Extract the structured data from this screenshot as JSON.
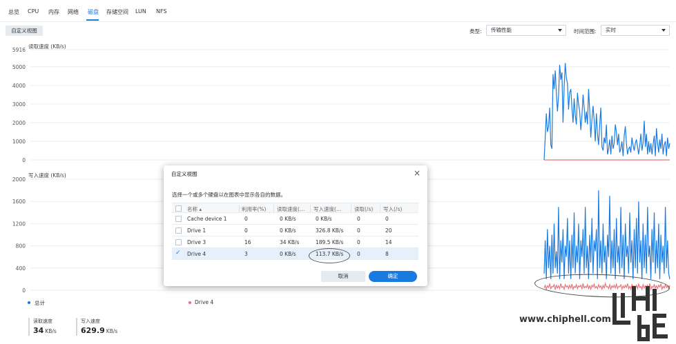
{
  "tabs": [
    {
      "label": "总览",
      "active": false
    },
    {
      "label": "CPU",
      "active": false
    },
    {
      "label": "内存",
      "active": false
    },
    {
      "label": "网络",
      "active": false
    },
    {
      "label": "磁盘",
      "active": true
    },
    {
      "label": "存储空间",
      "active": false
    },
    {
      "label": "LUN",
      "active": false
    },
    {
      "label": "NFS",
      "active": false
    }
  ],
  "toolbar": {
    "custom_view_label": "自定义视图",
    "type_label": "类型:",
    "type_value": "传输性能",
    "range_label": "时间范围:",
    "range_value": "实时"
  },
  "colors": {
    "accent": "#1a7ae0",
    "drive4": "#e8737a"
  },
  "chart_data": [
    {
      "type": "line",
      "ylabel": "读取速度 (KB/s)",
      "ylim": [
        0,
        5916
      ],
      "yticks": [
        "0",
        "1000",
        "2000",
        "3000",
        "4000",
        "5000",
        "5916"
      ],
      "yticks_values": [
        0,
        1000,
        2000,
        3000,
        4000,
        5000,
        5916
      ],
      "series": [
        {
          "name": "总计",
          "color": "#1a7ae0",
          "values": [
            0,
            1200,
            2500,
            1500,
            1800,
            2800,
            800,
            600,
            4600,
            3800,
            4800,
            3600,
            2600,
            3400,
            5100,
            4300,
            4700,
            2000,
            3900,
            5200,
            4400,
            4100,
            2700,
            3600,
            3800,
            2800,
            2000,
            3300,
            2400,
            1900,
            3600,
            3000,
            2600,
            1600,
            2400,
            3500,
            2800,
            2000,
            2600,
            1900,
            3800,
            2700,
            1200,
            2200,
            2900,
            2100,
            1000,
            2500,
            1400,
            800,
            1900,
            2800,
            700,
            500,
            1200,
            900,
            1900,
            300,
            600,
            1100,
            300,
            1300,
            600,
            900,
            1900,
            1500,
            800,
            1400,
            400,
            600,
            1000,
            200,
            1300,
            1800,
            900,
            300,
            600,
            700,
            400,
            1200,
            800,
            500,
            900,
            1100,
            700,
            300,
            800,
            1400,
            500,
            900,
            2100,
            700,
            1400,
            300,
            1000,
            400,
            900,
            300,
            800,
            1300,
            200,
            1700,
            900,
            400,
            1100,
            600,
            1400,
            300,
            800,
            1000,
            200,
            1200,
            600,
            900
          ]
        },
        {
          "name": "Drive 4",
          "color": "#e8737a",
          "values": [
            0,
            0,
            0,
            0,
            0,
            0,
            0,
            0,
            0,
            0,
            0,
            0,
            0,
            0,
            0,
            0,
            0,
            0,
            0,
            0,
            0,
            0,
            0,
            0,
            0,
            0,
            0,
            0,
            0,
            0,
            0,
            0,
            0,
            0,
            0,
            0,
            0,
            0,
            0,
            0,
            0,
            0,
            0,
            0,
            0,
            0,
            0,
            0,
            0,
            0,
            0,
            0,
            0,
            0,
            0,
            0,
            0,
            0,
            0,
            0,
            0,
            0,
            0,
            0,
            0,
            0,
            0,
            0,
            0,
            0,
            0,
            0,
            0,
            0,
            0,
            0,
            0,
            0,
            0,
            0,
            0,
            0,
            0,
            0,
            0,
            0,
            0,
            0,
            0,
            0,
            0,
            0,
            0,
            0,
            0,
            0,
            0,
            0,
            0,
            0,
            0,
            0,
            0,
            0,
            0,
            0,
            0,
            0,
            0,
            0,
            0,
            0,
            0,
            0
          ]
        }
      ]
    },
    {
      "type": "line",
      "ylabel": "写入速度 (KB/s)",
      "ylim": [
        0,
        2000
      ],
      "yticks": [
        "0",
        "400",
        "800",
        "1200",
        "1600",
        "2000"
      ],
      "yticks_values": [
        0,
        400,
        800,
        1200,
        1600,
        2000
      ],
      "series": [
        {
          "name": "总计",
          "color": "#1a7ae0",
          "values": [
            300,
            900,
            200,
            1100,
            400,
            800,
            200,
            1000,
            300,
            1200,
            400,
            700,
            300,
            1500,
            200,
            900,
            500,
            1100,
            200,
            800,
            600,
            1300,
            300,
            900,
            200,
            1000,
            400,
            1400,
            300,
            800,
            500,
            1200,
            200,
            900,
            600,
            1100,
            300,
            1500,
            400,
            800,
            200,
            1000,
            500,
            1300,
            300,
            900,
            700,
            1100,
            200,
            1800,
            400,
            900,
            300,
            1200,
            500,
            800,
            200,
            1000,
            600,
            1700,
            300,
            900,
            400,
            1100,
            200,
            1300,
            500,
            800,
            300,
            1500,
            400,
            1000,
            200,
            1200,
            600,
            800,
            300,
            1400,
            500,
            900,
            200,
            1100,
            400,
            1300,
            300,
            1600,
            500,
            900,
            200,
            1200,
            400,
            1000,
            300,
            1500,
            600,
            800,
            200,
            1100,
            500,
            1400,
            300,
            900,
            400,
            1200,
            200,
            1000,
            500,
            800,
            300,
            1500,
            400,
            900,
            300,
            200
          ]
        },
        {
          "name": "Drive 4",
          "color": "#e8737a",
          "values": [
            40,
            90,
            20,
            80,
            50,
            110,
            30,
            70,
            60,
            100,
            20,
            90,
            40,
            80,
            30,
            120,
            50,
            70,
            20,
            100,
            60,
            80,
            30,
            90,
            40,
            110,
            20,
            70,
            50,
            100,
            30,
            80,
            60,
            90,
            20,
            120,
            40,
            70,
            50,
            100,
            30,
            80,
            20,
            90,
            60,
            110,
            40,
            70,
            30,
            100,
            50,
            80,
            20,
            90,
            40,
            120,
            60,
            70,
            30,
            100,
            20,
            80,
            50,
            90,
            40,
            110,
            30,
            70,
            60,
            100,
            20,
            80,
            40,
            90,
            50,
            120,
            30,
            70,
            20,
            100,
            60,
            80,
            40,
            90,
            30,
            110,
            50,
            70,
            20,
            100,
            40,
            80,
            60,
            90,
            30,
            120,
            20,
            70,
            50,
            100,
            40,
            80,
            30,
            90,
            60,
            110,
            20,
            70,
            40,
            100,
            50,
            80,
            30,
            90
          ]
        }
      ]
    }
  ],
  "legend": {
    "total_label": "总计",
    "drive4_label": "Drive 4"
  },
  "stats": {
    "read_label": "读取速度",
    "read_value": "34",
    "read_unit": "KB/s",
    "write_label": "写入速度",
    "write_value": "629.9",
    "write_unit": "KB/s"
  },
  "dialog": {
    "title": "自定义视图",
    "close_label": "×",
    "description": "选择一个或多个硬盘以在图表中显示各自的数据。",
    "columns": [
      "名称 ▴",
      "利用率(%)",
      "读取速度(…",
      "写入速度(…",
      "读取(/s)",
      "写入(/s)"
    ],
    "rows": [
      {
        "name": "Cache device 1",
        "util": "0",
        "read": "0 KB/s",
        "write": "0 KB/s",
        "rps": "0",
        "wps": "0",
        "checked": false
      },
      {
        "name": "Drive 1",
        "util": "0",
        "read": "0 KB/s",
        "write": "326.8 KB/s",
        "rps": "0",
        "wps": "20",
        "checked": false
      },
      {
        "name": "Drive 3",
        "util": "16",
        "read": "34 KB/s",
        "write": "189.5 KB/s",
        "rps": "0",
        "wps": "14",
        "checked": false
      },
      {
        "name": "Drive 4",
        "util": "3",
        "read": "0 KB/s",
        "write": "113.7 KB/s",
        "rps": "0",
        "wps": "8",
        "checked": true
      }
    ],
    "cancel_label": "取消",
    "ok_label": "确定"
  },
  "watermark": "www.chiphell.com"
}
